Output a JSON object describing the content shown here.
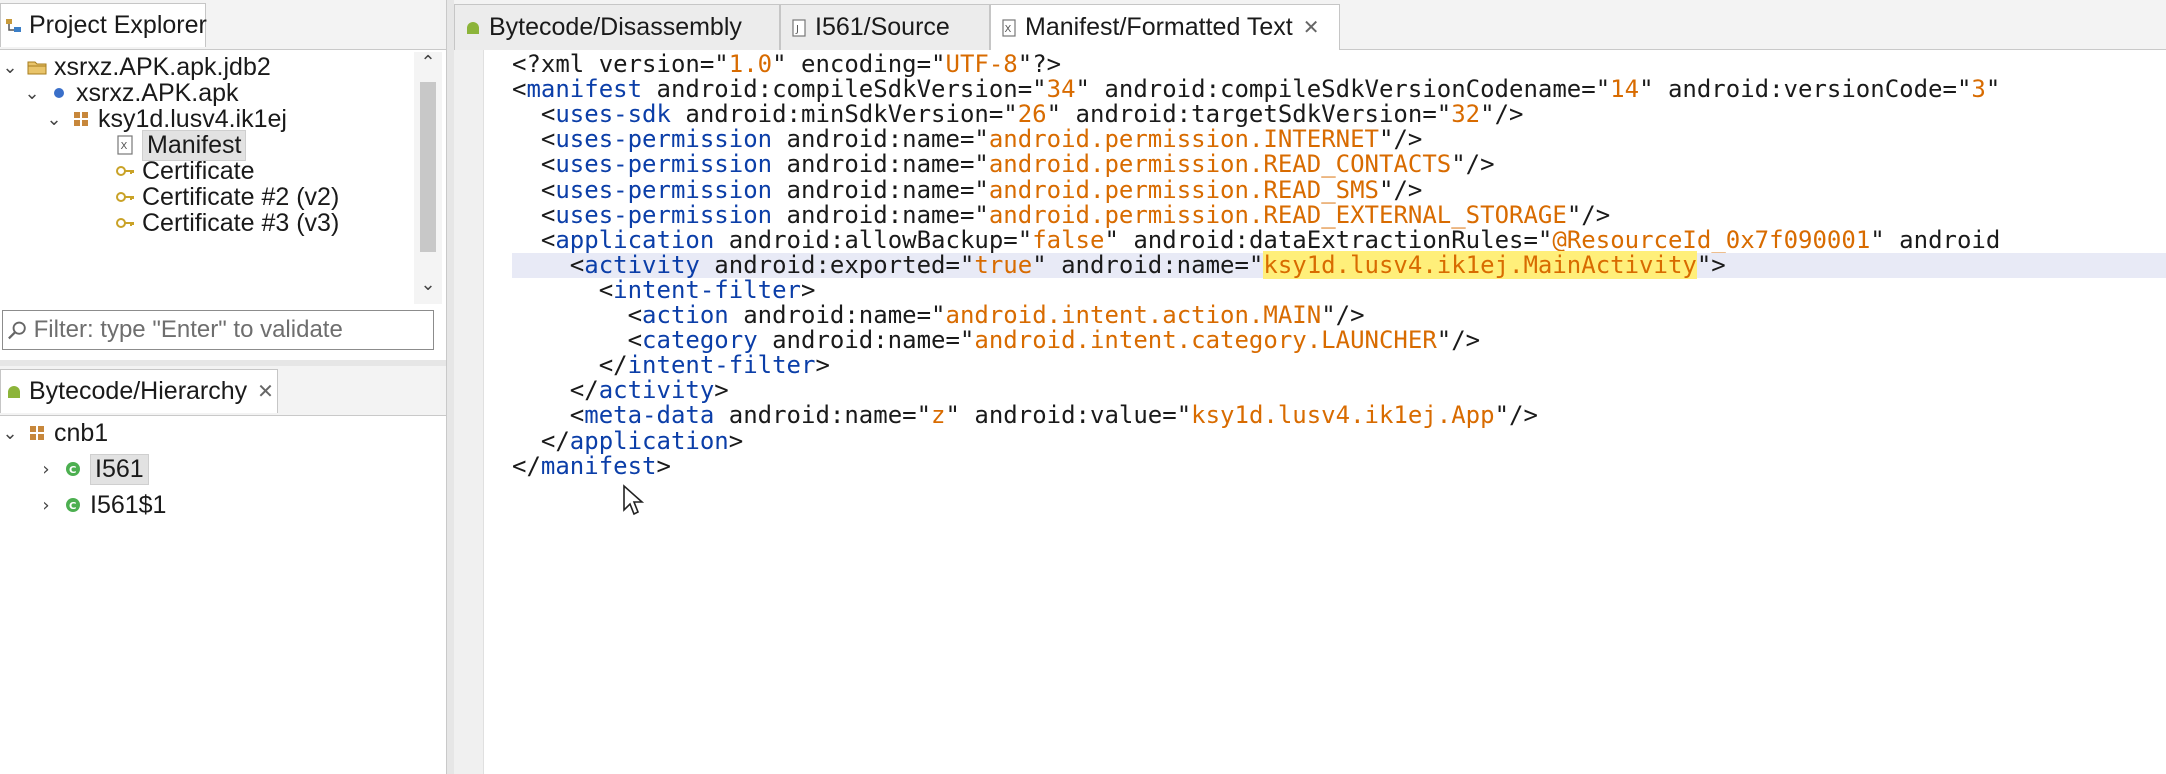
{
  "project_explorer": {
    "title": "Project Explorer",
    "tree": [
      {
        "label": "xsrxz.APK.apk.jdb2",
        "level": 0,
        "expanded": true,
        "icon": "project-folder-icon"
      },
      {
        "label": "xsrxz.APK.apk",
        "level": 1,
        "expanded": true,
        "icon": "apk-icon"
      },
      {
        "label": "ksy1d.lusv4.ik1ej",
        "level": 2,
        "expanded": true,
        "icon": "package-icon"
      },
      {
        "label": "Manifest",
        "level": 3,
        "selected": true,
        "icon": "manifest-icon"
      },
      {
        "label": "Certificate",
        "level": 3,
        "icon": "key-icon"
      },
      {
        "label": "Certificate #2 (v2)",
        "level": 3,
        "icon": "key-icon"
      },
      {
        "label": "Certificate #3 (v3)",
        "level": 3,
        "icon": "key-icon"
      }
    ],
    "filter_placeholder": "Filter: type \"Enter\" to validate"
  },
  "hierarchy": {
    "title": "Bytecode/Hierarchy",
    "tree": [
      {
        "label": "cnb1",
        "level": 0,
        "expanded": true,
        "icon": "package-icon"
      },
      {
        "label": "I561",
        "level": 1,
        "selected": true,
        "icon": "class-icon"
      },
      {
        "label": "I561$1",
        "level": 1,
        "icon": "class-icon"
      }
    ]
  },
  "editor": {
    "tabs": [
      {
        "label": "Bytecode/Disassembly",
        "icon": "android-icon",
        "active": false
      },
      {
        "label": "I561/Source",
        "icon": "source-file-icon",
        "active": false
      },
      {
        "label": "Manifest/Formatted Text",
        "icon": "manifest-icon",
        "active": true,
        "closable": true
      }
    ],
    "highlighted_line": 8,
    "lines": [
      [
        [
          "p",
          "<?xml version=\""
        ],
        [
          "v",
          "1.0"
        ],
        [
          "p",
          "\" encoding=\""
        ],
        [
          "v",
          "UTF-8"
        ],
        [
          "p",
          "\"?>"
        ]
      ],
      [
        [
          "p",
          "<"
        ],
        [
          "t",
          "manifest"
        ],
        [
          "a",
          " android:compileSdkVersion=\""
        ],
        [
          "v",
          "34"
        ],
        [
          "a",
          "\" android:compileSdkVersionCodename=\""
        ],
        [
          "v",
          "14"
        ],
        [
          "a",
          "\" android:versionCode=\""
        ],
        [
          "v",
          "3"
        ],
        [
          "a",
          "\""
        ]
      ],
      [
        [
          "p",
          "  <"
        ],
        [
          "t",
          "uses-sdk"
        ],
        [
          "a",
          " android:minSdkVersion=\""
        ],
        [
          "v",
          "26"
        ],
        [
          "a",
          "\" android:targetSdkVersion=\""
        ],
        [
          "v",
          "32"
        ],
        [
          "p",
          "\"/>"
        ]
      ],
      [
        [
          "p",
          "  <"
        ],
        [
          "t",
          "uses-permission"
        ],
        [
          "a",
          " android:name=\""
        ],
        [
          "v",
          "android.permission.INTERNET"
        ],
        [
          "p",
          "\"/>"
        ]
      ],
      [
        [
          "p",
          "  <"
        ],
        [
          "t",
          "uses-permission"
        ],
        [
          "a",
          " android:name=\""
        ],
        [
          "v",
          "android.permission.READ_CONTACTS"
        ],
        [
          "p",
          "\"/>"
        ]
      ],
      [
        [
          "p",
          "  <"
        ],
        [
          "t",
          "uses-permission"
        ],
        [
          "a",
          " android:name=\""
        ],
        [
          "v",
          "android.permission.READ_SMS"
        ],
        [
          "p",
          "\"/>"
        ]
      ],
      [
        [
          "p",
          "  <"
        ],
        [
          "t",
          "uses-permission"
        ],
        [
          "a",
          " android:name=\""
        ],
        [
          "v",
          "android.permission.READ_EXTERNAL_STORAGE"
        ],
        [
          "p",
          "\"/>"
        ]
      ],
      [
        [
          "p",
          "  <"
        ],
        [
          "t",
          "application"
        ],
        [
          "a",
          " android:allowBackup=\""
        ],
        [
          "v",
          "false"
        ],
        [
          "a",
          "\" android:dataExtractionRules=\""
        ],
        [
          "v",
          "@ResourceId_0x7f090001"
        ],
        [
          "a",
          "\" android"
        ]
      ],
      [
        [
          "p",
          "    <"
        ],
        [
          "t",
          "activity"
        ],
        [
          "a",
          " android:exported=\""
        ],
        [
          "v",
          "true"
        ],
        [
          "a",
          "\" android:name=\""
        ],
        [
          "h",
          "ksy1d.lusv4.ik1ej.MainActivity"
        ],
        [
          "p",
          "\">"
        ]
      ],
      [
        [
          "p",
          "      <"
        ],
        [
          "t",
          "intent-filter"
        ],
        [
          "p",
          ">"
        ]
      ],
      [
        [
          "p",
          "        <"
        ],
        [
          "t",
          "action"
        ],
        [
          "a",
          " android:name=\""
        ],
        [
          "v",
          "android.intent.action.MAIN"
        ],
        [
          "p",
          "\"/>"
        ]
      ],
      [
        [
          "p",
          "        <"
        ],
        [
          "t",
          "category"
        ],
        [
          "a",
          " android:name=\""
        ],
        [
          "v",
          "android.intent.category.LAUNCHER"
        ],
        [
          "p",
          "\"/>"
        ]
      ],
      [
        [
          "p",
          "      </"
        ],
        [
          "t",
          "intent-filter"
        ],
        [
          "p",
          ">"
        ]
      ],
      [
        [
          "p",
          "    </"
        ],
        [
          "t",
          "activity"
        ],
        [
          "p",
          ">"
        ]
      ],
      [
        [
          "p",
          "    <"
        ],
        [
          "t",
          "meta-data"
        ],
        [
          "a",
          " android:name=\""
        ],
        [
          "v",
          "z"
        ],
        [
          "a",
          "\" android:value=\""
        ],
        [
          "v",
          "ksy1d.lusv4.ik1ej.App"
        ],
        [
          "p",
          "\"/>"
        ]
      ],
      [
        [
          "p",
          "  </"
        ],
        [
          "t",
          "application"
        ],
        [
          "p",
          ">"
        ]
      ],
      [
        [
          "p",
          "</"
        ],
        [
          "t",
          "manifest"
        ],
        [
          "p",
          ">"
        ]
      ]
    ]
  },
  "colors": {
    "tag": "#0b3ea8",
    "value": "#d86b00",
    "selection_highlight": "#ffef7a",
    "current_line": "#e8eaf6"
  }
}
